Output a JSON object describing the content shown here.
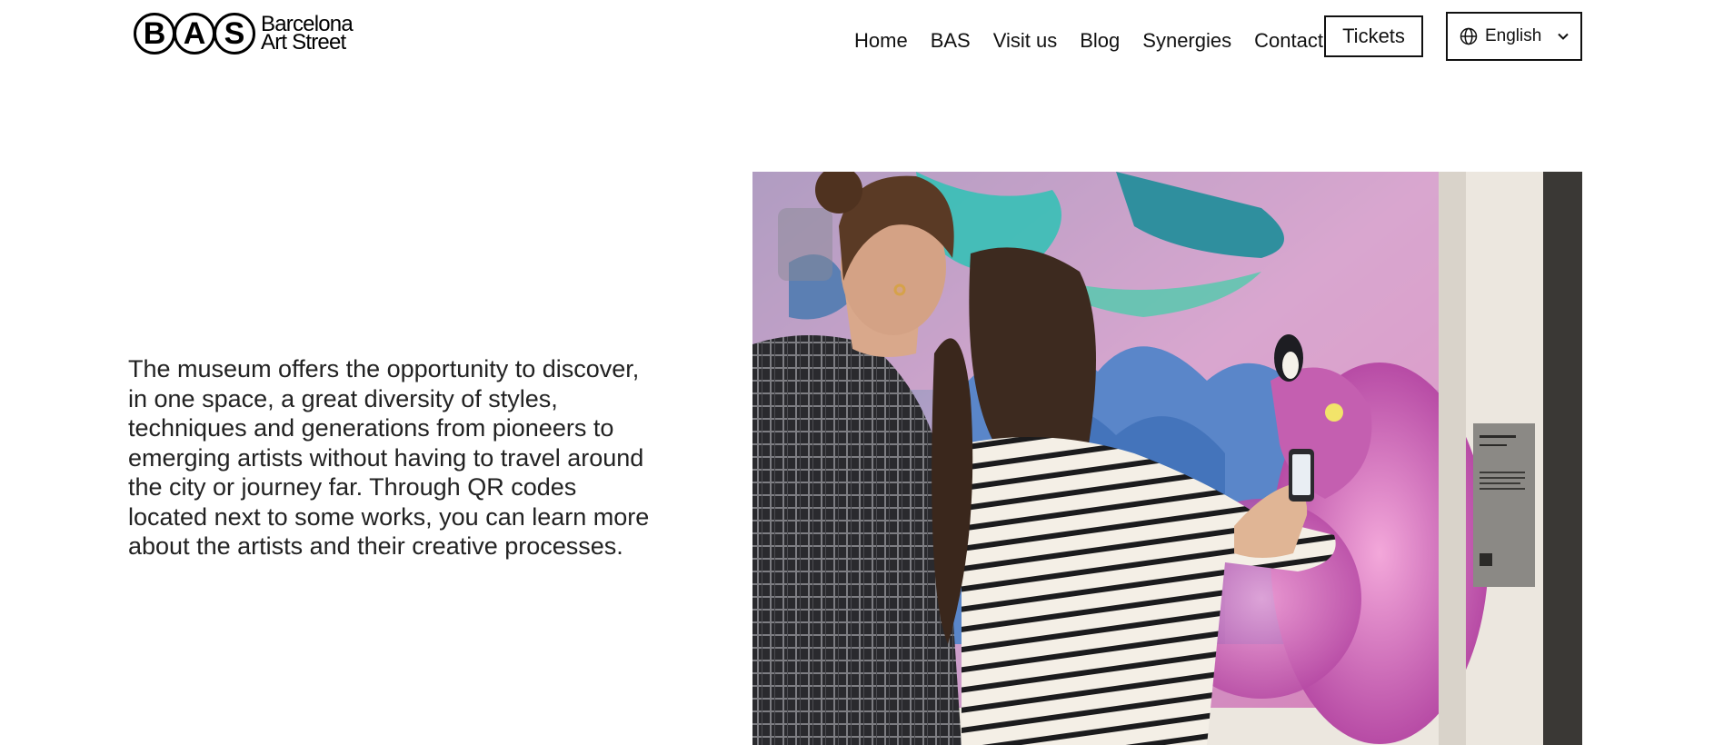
{
  "brand": {
    "logo_letters": [
      "B",
      "A",
      "S"
    ],
    "name_line1": "Barcelona",
    "name_line2": "Art Street"
  },
  "nav": {
    "items": [
      {
        "label": "Home"
      },
      {
        "label": "BAS"
      },
      {
        "label": "Visit us"
      },
      {
        "label": "Blog"
      },
      {
        "label": "Synergies"
      },
      {
        "label": "Contact"
      }
    ]
  },
  "actions": {
    "tickets_label": "Tickets",
    "language": {
      "selected": "English",
      "icon": "globe-icon",
      "chevron": "chevron-down-icon"
    }
  },
  "main": {
    "intro_text": "The museum offers the opportunity to discover, in one space, a great diversity of styles, techniques and generations from pioneers to emerging artists without having to travel around the city or journey far. Through QR codes located next to some works, you can learn more about the artists and their creative processes."
  },
  "colors": {
    "text": "#111111",
    "background": "#ffffff"
  }
}
